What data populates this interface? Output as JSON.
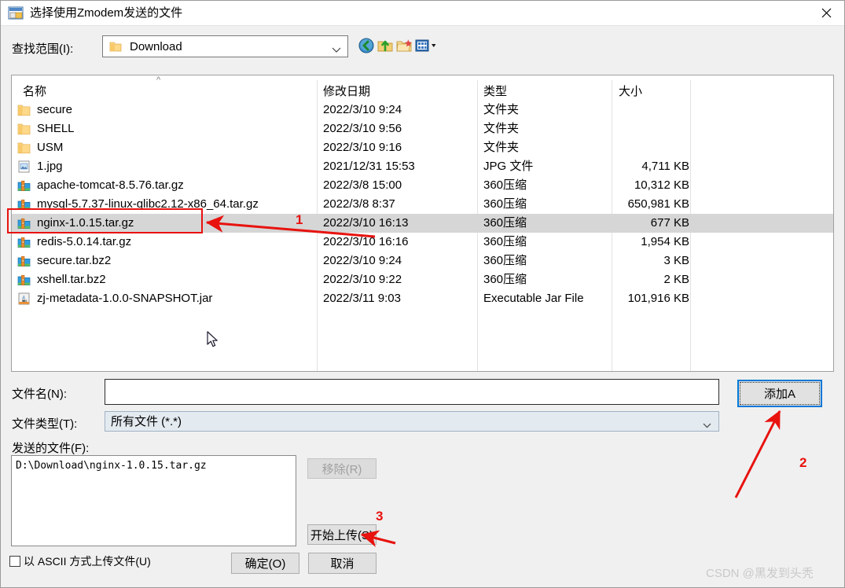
{
  "window": {
    "title": "选择使用Zmodem发送的文件",
    "icon": "zmodem-send-icon",
    "close_label": "✕"
  },
  "toolbar": {
    "lookin_label": "查找范围(I):",
    "lookin_value": "Download",
    "lookin_icon": "folder-icon",
    "buttons": [
      {
        "name": "back-button",
        "icon": "back-arrow-icon"
      },
      {
        "name": "up-folder-button",
        "icon": "up-folder-icon"
      },
      {
        "name": "new-folder-button",
        "icon": "new-folder-icon"
      },
      {
        "name": "views-button",
        "icon": "views-icon"
      }
    ]
  },
  "filelist": {
    "sort_indicator": "^",
    "columns": [
      {
        "key": "name",
        "label": "名称"
      },
      {
        "key": "date",
        "label": "修改日期"
      },
      {
        "key": "type",
        "label": "类型"
      },
      {
        "key": "size",
        "label": "大小"
      }
    ],
    "rows": [
      {
        "name": "secure",
        "date": "2022/3/10 9:24",
        "type": "文件夹",
        "size": "",
        "icon": "folder-icon",
        "selected": false
      },
      {
        "name": "SHELL",
        "date": "2022/3/10 9:56",
        "type": "文件夹",
        "size": "",
        "icon": "folder-icon",
        "selected": false
      },
      {
        "name": "USM",
        "date": "2022/3/10 9:16",
        "type": "文件夹",
        "size": "",
        "icon": "folder-icon",
        "selected": false
      },
      {
        "name": "1.jpg",
        "date": "2021/12/31 15:53",
        "type": "JPG 文件",
        "size": "4,711 KB",
        "icon": "image-file-icon",
        "selected": false
      },
      {
        "name": "apache-tomcat-8.5.76.tar.gz",
        "date": "2022/3/8 15:00",
        "type": "360压缩",
        "size": "10,312 KB",
        "icon": "archive-icon",
        "selected": false
      },
      {
        "name": "mysql-5.7.37-linux-glibc2.12-x86_64.tar.gz",
        "date": "2022/3/8 8:37",
        "type": "360压缩",
        "size": "650,981 KB",
        "icon": "archive-icon",
        "selected": false
      },
      {
        "name": "nginx-1.0.15.tar.gz",
        "date": "2022/3/10 16:13",
        "type": "360压缩",
        "size": "677 KB",
        "icon": "archive-icon",
        "selected": true
      },
      {
        "name": "redis-5.0.14.tar.gz",
        "date": "2022/3/10 16:16",
        "type": "360压缩",
        "size": "1,954 KB",
        "icon": "archive-icon",
        "selected": false
      },
      {
        "name": "secure.tar.bz2",
        "date": "2022/3/10 9:24",
        "type": "360压缩",
        "size": "3 KB",
        "icon": "archive-icon",
        "selected": false
      },
      {
        "name": "xshell.tar.bz2",
        "date": "2022/3/10 9:22",
        "type": "360压缩",
        "size": "2 KB",
        "icon": "archive-icon",
        "selected": false
      },
      {
        "name": "zj-metadata-1.0.0-SNAPSHOT.jar",
        "date": "2022/3/11 9:03",
        "type": "Executable Jar File",
        "size": "101,916 KB",
        "icon": "jar-file-icon",
        "selected": false
      }
    ]
  },
  "form": {
    "filename_label": "文件名(N):",
    "filename_value": "",
    "filetype_label": "文件类型(T):",
    "filetype_value": "所有文件 (*.*)",
    "sendfiles_label": "发送的文件(F):",
    "sendfiles_items": [
      "D:\\Download\\nginx-1.0.15.tar.gz"
    ]
  },
  "buttons": {
    "add": "添加A",
    "remove": "移除(R)",
    "upload": "开始上传(S)",
    "ok": "确定(O)",
    "cancel": "取消"
  },
  "checkbox": {
    "ascii_label": "以 ASCII 方式上传文件(U)",
    "checked": false
  },
  "annotations": {
    "color": "#e8120e",
    "marks": [
      {
        "id": "1",
        "target": "nginx-row"
      },
      {
        "id": "2",
        "target": "add-button"
      },
      {
        "id": "3",
        "target": "upload-button"
      }
    ]
  },
  "watermark": "CSDN @黑发到头秃"
}
